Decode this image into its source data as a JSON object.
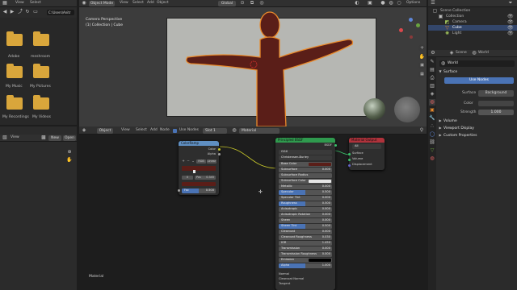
{
  "file_browser": {
    "menu": [
      "View",
      "Select"
    ],
    "path": "C:\\Users\\Anitr",
    "folders": [
      {
        "label": "Adobe"
      },
      {
        "label": "meshroom"
      },
      {
        "label": "My Music"
      },
      {
        "label": "My Pictures"
      },
      {
        "label": "My Recordings"
      },
      {
        "label": "My Videos"
      }
    ]
  },
  "viewport": {
    "mode": "Object Mode",
    "menu": [
      "View",
      "Select",
      "Add",
      "Object"
    ],
    "orientation": "Global",
    "info_line1": "Camera Perspective",
    "info_line2": "(1) Collection | Cube",
    "options_label": "Options"
  },
  "node_editor": {
    "editor_mode": "Object",
    "menu": [
      "View",
      "Select",
      "Add",
      "Node"
    ],
    "use_nodes_label": "Use Nodes",
    "slot": "Slot 1",
    "material": "Material",
    "footer_label": "Material"
  },
  "image_editor": {
    "menu": [
      "View"
    ],
    "new_label": "New",
    "open_label": "Open"
  },
  "color_ramp": {
    "title": "ColorRamp",
    "out_color": "Color",
    "out_alpha": "Alpha",
    "interp_mode": "RGB",
    "interp": "Linear",
    "stop_index": "0",
    "pos_label": "Pos",
    "pos_value": "0.345",
    "fac_label": "Fac",
    "fac_value": "0.500"
  },
  "bsdf": {
    "title": "Principled BSDF",
    "out": "BSDF",
    "distribution": "GGX",
    "subsurface_method": "Christensen-Burley",
    "rows": [
      {
        "label": "Base Color",
        "value": ""
      },
      {
        "label": "Subsurface",
        "value": "0.000"
      },
      {
        "label": "Subsurface Radius",
        "value": ""
      },
      {
        "label": "Subsurface Color",
        "value": ""
      },
      {
        "label": "Metallic",
        "value": "0.000"
      },
      {
        "label": "Specular",
        "value": "0.500"
      },
      {
        "label": "Specular Tint",
        "value": "0.000"
      },
      {
        "label": "Roughness",
        "value": "0.500"
      },
      {
        "label": "Anisotropic",
        "value": "0.000"
      },
      {
        "label": "Anisotropic Rotation",
        "value": "0.000"
      },
      {
        "label": "Sheen",
        "value": "0.000"
      },
      {
        "label": "Sheen Tint",
        "value": "0.500"
      },
      {
        "label": "Clearcoat",
        "value": "0.000"
      },
      {
        "label": "Clearcoat Roughness",
        "value": "0.030"
      },
      {
        "label": "IOR",
        "value": "1.450"
      },
      {
        "label": "Transmission",
        "value": "0.000"
      },
      {
        "label": "Transmission Roughness",
        "value": "0.000"
      },
      {
        "label": "Emission",
        "value": ""
      },
      {
        "label": "Alpha",
        "value": "1.000"
      }
    ],
    "vectors": [
      "Normal",
      "Clearcoat Normal",
      "Tangent"
    ]
  },
  "material_output": {
    "title": "Material Output",
    "target": "All",
    "inputs": [
      "Surface",
      "Volume",
      "Displacement"
    ]
  },
  "outliner": {
    "root": "Scene Collection",
    "items": [
      {
        "label": "Collection"
      },
      {
        "label": "Camera"
      },
      {
        "label": "Cube"
      },
      {
        "label": "Light"
      }
    ]
  },
  "properties": {
    "tabs": [
      "Scene",
      "World"
    ],
    "world_name": "World",
    "surface_section": "Surface",
    "use_nodes_label": "Use Nodes",
    "surface_label": "Surface",
    "surface_value": "Background",
    "color_label": "Color",
    "strength_label": "Strength",
    "strength_value": "1.000",
    "sections": [
      "Volume",
      "Viewport Display",
      "Custom Properties"
    ]
  },
  "colors": {
    "accent": "#4a73b5",
    "bsdf_header": "#2f9a4e",
    "output_header": "#b0323b",
    "ramp_header": "#5f8fc2",
    "character": "#5a1e18",
    "selection": "#e98a2b"
  }
}
